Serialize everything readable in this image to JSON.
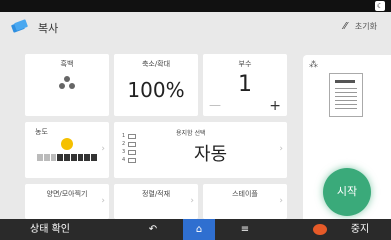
{
  "header": {
    "app_title": "복사",
    "reset_label": "초기화",
    "reset_icon": "broom-icon",
    "app_icon": "copy-icon"
  },
  "tiles": {
    "color": {
      "label": "흑백"
    },
    "zoom": {
      "label": "축소/확대",
      "value": "100%"
    },
    "copies": {
      "label": "부수",
      "value": "1",
      "minus": "—",
      "plus": "+"
    },
    "density": {
      "label": "농도"
    },
    "paper": {
      "label": "용지함 선택",
      "value": "자동",
      "trays": [
        "1",
        "2",
        "3",
        "4"
      ]
    },
    "duplex": {
      "label": "양면/모아찍기"
    },
    "sort": {
      "label": "정렬/적재"
    },
    "staple": {
      "label": "스테이플"
    }
  },
  "start": {
    "label": "시작"
  },
  "bottom": {
    "status": "상태 확인",
    "stop": "중지",
    "back_icon": "back-arrow-icon",
    "home_icon": "home-icon",
    "menu_icon": "menu-icon"
  },
  "colors": {
    "start": "#3aaa7a",
    "home_active": "#2f6fd0",
    "stop": "#e65a28",
    "density_bulb": "#f5c000"
  }
}
